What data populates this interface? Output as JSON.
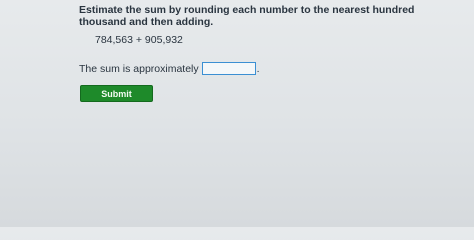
{
  "question": {
    "prompt": "Estimate the sum by rounding each number to the nearest hundred thousand and then adding.",
    "expression": "784,563 + 905,932"
  },
  "answer": {
    "label": "The sum is approximately",
    "value": "",
    "suffix": "."
  },
  "submit": {
    "label": "Submit"
  },
  "colors": {
    "submit_background": "#1e8a2a",
    "input_border": "#3b8fd3"
  }
}
